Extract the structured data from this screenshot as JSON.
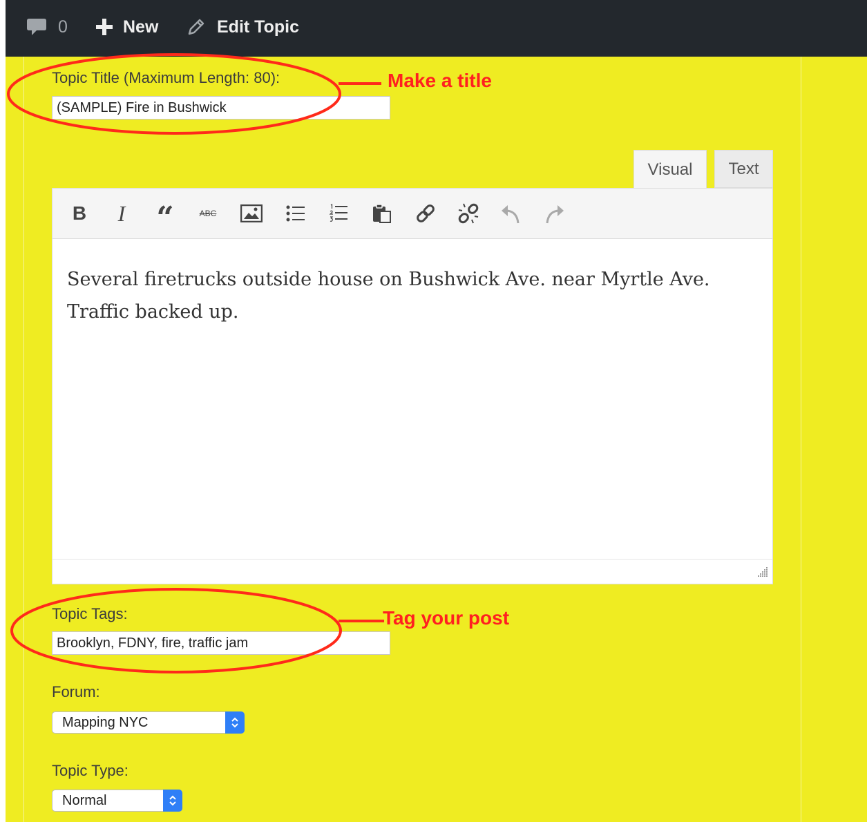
{
  "admin_bar": {
    "comments_count": "0",
    "new_label": "New",
    "edit_label": "Edit Topic"
  },
  "form": {
    "title_label": "Topic Title (Maximum Length: 80):",
    "title_value": "(SAMPLE) Fire in Bushwick",
    "tabs": [
      {
        "label": "Visual",
        "active": true
      },
      {
        "label": "Text",
        "active": false
      }
    ],
    "toolbar_icons": [
      "bold-icon",
      "italic-icon",
      "blockquote-icon",
      "strikethrough-icon",
      "image-icon",
      "bullet-list-icon",
      "numbered-list-icon",
      "paste-icon",
      "link-icon",
      "unlink-icon",
      "undo-icon",
      "redo-icon"
    ],
    "toolbar_glyphs": {
      "bold": "B",
      "italic": "I",
      "quote": "“",
      "strike": "ABC"
    },
    "content_lines": [
      "Several firetrucks outside house on Bushwick Ave. near Myrtle Ave.",
      "Traffic backed up."
    ],
    "tags_label": "Topic Tags:",
    "tags_value": "Brooklyn, FDNY, fire, traffic jam",
    "forum_label": "Forum:",
    "forum_value": "Mapping NYC",
    "type_label": "Topic Type:",
    "type_value": "Normal"
  },
  "annotations": {
    "title_note": "Make a title",
    "tags_note": "Tag your post",
    "color": "#ff2020"
  },
  "colors": {
    "page_background": "#efec22",
    "admin_bar": "#23282d",
    "select_accent": "#2f7ff7"
  }
}
